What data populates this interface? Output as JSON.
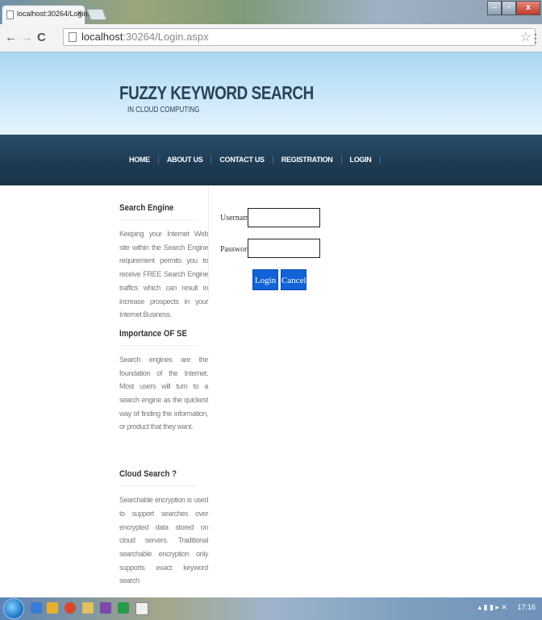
{
  "browser": {
    "tab_title": "localhost:30264/Login.asp",
    "tab_close": "x",
    "url_host": "localhost",
    "url_rest": ":30264/Login.aspx"
  },
  "site": {
    "title": "FUZZY KEYWORD SEARCH",
    "subtitle": "IN CLOUD COMPUTING"
  },
  "nav": {
    "items": [
      "HOME",
      "ABOUT US",
      "CONTACT US",
      "REGISTRATION",
      "LOGIN"
    ]
  },
  "sidebar": {
    "sections": [
      {
        "heading": "Search Engine",
        "text": "Keeping your Internet Web site within the Search Engine requirement permits you to receive FREE Search Engine traffics which can result in increase prospects in your Internet Business."
      },
      {
        "heading": "Importance OF SE",
        "text": "Search engines are the foundation of the Internet. Most users will turn to a search engine as the quickest way of finding the information, or product that they want."
      },
      {
        "heading": "Cloud Search ?",
        "text": "Searchable encryption is used to support searches over encrypted data stored on cloud servers. Traditional searchable encryption only supports exact keyword search"
      }
    ]
  },
  "login": {
    "username_label": "Username :",
    "password_label": "Password :",
    "username_value": "",
    "password_value": "",
    "login_button": "Login",
    "cancel_button": "Cancel"
  },
  "taskbar": {
    "clock": "17:16"
  },
  "colors": {
    "header_top": "#a8d8f3",
    "nav_bg": "#1d3a52",
    "button_bg": "#1262d8",
    "title_text": "#2d4255"
  }
}
